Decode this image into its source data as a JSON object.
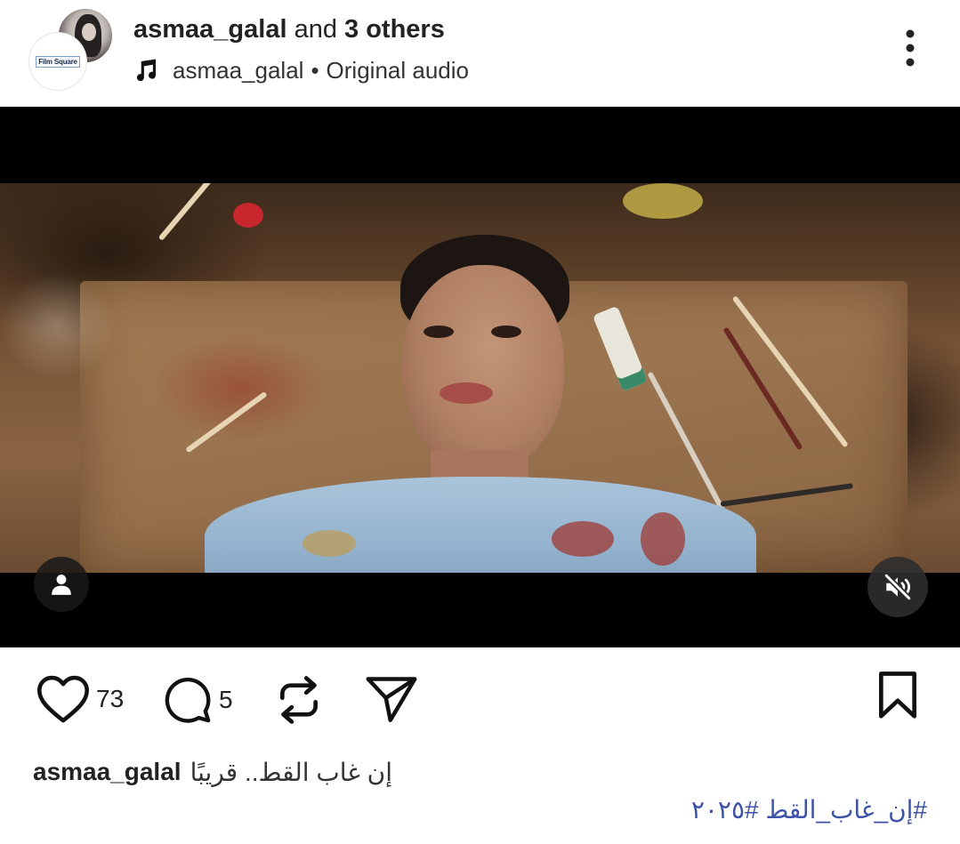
{
  "header": {
    "username": "asmaa_galal",
    "collab_connector": "and",
    "collab_others": "3 others",
    "audio_owner": "asmaa_galal",
    "audio_separator": "•",
    "audio_label": "Original audio",
    "second_avatar_logo": "Film Square",
    "icons": {
      "music": "music-note-icon",
      "more": "more-vertical-icon"
    }
  },
  "video": {
    "icons": {
      "profile": "person-icon",
      "mute": "speaker-muted-icon"
    }
  },
  "actions": {
    "likes": "73",
    "comments": "5",
    "icons": {
      "like": "heart-icon",
      "comment": "comment-bubble-icon",
      "repost": "repost-icon",
      "share": "send-icon",
      "save": "bookmark-icon"
    }
  },
  "caption": {
    "username": "asmaa_galal",
    "text": "إن غاب القط.. قريبًا",
    "hashtag": "#إن_غاب_القط #٢٠٢٥"
  },
  "colors": {
    "hashtag": "#3d53a8",
    "text": "#222222",
    "video_background": "#000000"
  }
}
